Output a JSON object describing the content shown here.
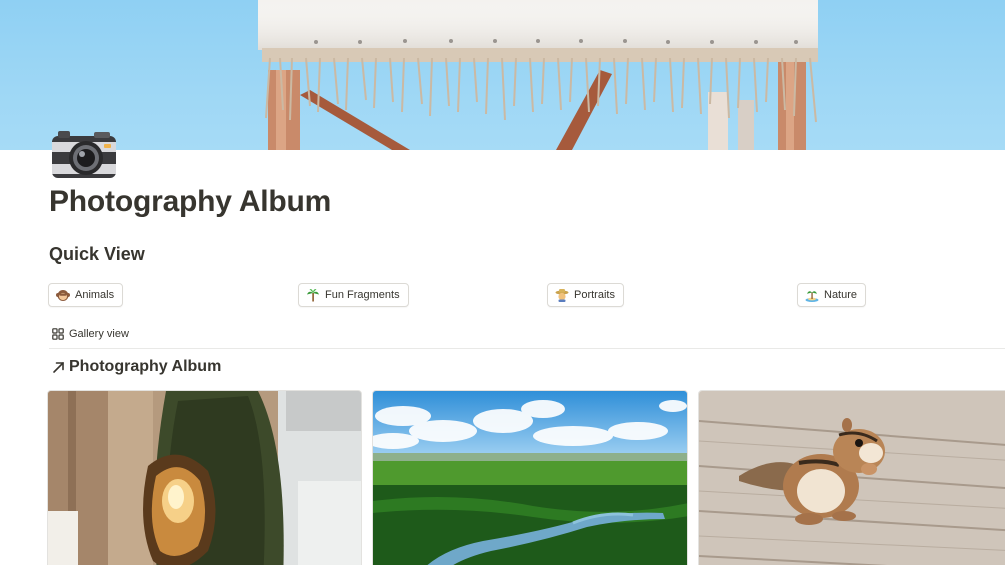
{
  "page": {
    "title": "Photography Album",
    "icon": "camera-icon",
    "cover": "cover-image-canopy-sky"
  },
  "quick_view": {
    "heading": "Quick View",
    "buttons": [
      {
        "label": "Animals",
        "icon": "monkey-icon"
      },
      {
        "label": "Fun Fragments",
        "icon": "palm-tree-icon"
      },
      {
        "label": "Portraits",
        "icon": "farmer-icon"
      },
      {
        "label": "Nature",
        "icon": "island-icon"
      }
    ]
  },
  "database": {
    "view_label": "Gallery view",
    "view_icon": "gallery-grid-icon",
    "title": "Photography Album",
    "title_icon": "arrow-up-right-icon",
    "cards": [
      {
        "image": "tree-stump-photo"
      },
      {
        "image": "river-landscape-photo"
      },
      {
        "image": "chipmunk-photo"
      }
    ]
  },
  "colors": {
    "text": "#37352f",
    "border": "#dcdad5",
    "sky": "#9ed7f5"
  }
}
